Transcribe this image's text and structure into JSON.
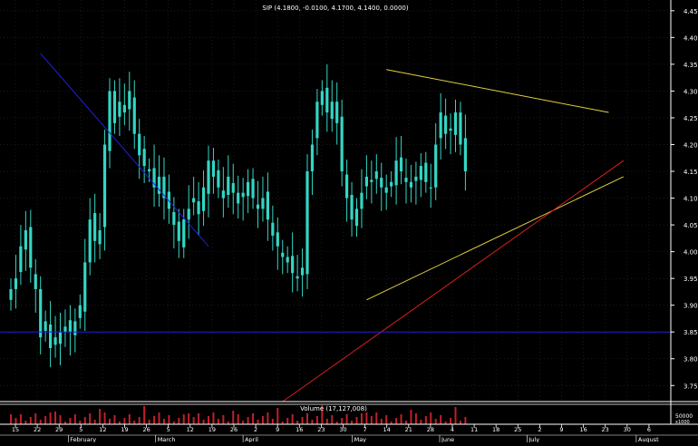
{
  "header": {
    "title": "SIP (4.1800, -0.0100, 4.1700, 4.1400, 0.0000)"
  },
  "volume_label": "Volume (17,127,008)",
  "colors": {
    "background": "#000000",
    "candle": "#33d6c4",
    "downtrend": "#1e22d8",
    "uptrend": "#d81e1e",
    "channel": "#e0d040",
    "support": "#1e22d8",
    "volume": "#c0202a",
    "axis": "#ffffff",
    "grid": "#2a2a2a"
  },
  "chart_data": {
    "type": "candlestick",
    "title": "SIP (4.1800, -0.0100, 4.1700, 4.1400, 0.0000)",
    "ylim": [
      3.72,
      4.47
    ],
    "y_ticks": [
      3.75,
      3.8,
      3.85,
      3.9,
      3.95,
      4.0,
      4.05,
      4.1,
      4.15,
      4.2,
      4.25,
      4.3,
      4.35,
      4.4,
      4.45
    ],
    "x_ticks": [
      "15",
      "22",
      "29",
      "5",
      "12",
      "19",
      "26",
      "5",
      "12",
      "19",
      "26",
      "2",
      "9",
      "16",
      "23",
      "30",
      "7",
      "14",
      "21",
      "28",
      "4",
      "11",
      "18",
      "25",
      "2",
      "9",
      "16",
      "23",
      "30",
      "6"
    ],
    "months": [
      "February",
      "March",
      "April",
      "May",
      "June",
      "July",
      "August"
    ],
    "volume_ticks": [
      "50000",
      "x1000"
    ],
    "closes": [
      3.93,
      3.95,
      4.01,
      4.04,
      3.97,
      3.93,
      3.84,
      3.87,
      3.82,
      3.84,
      3.85,
      3.86,
      3.85,
      3.87,
      3.9,
      3.98,
      4.06,
      4.02,
      4.04,
      4.2,
      4.3,
      4.24,
      4.28,
      4.26,
      4.3,
      4.22,
      4.18,
      4.16,
      4.15,
      4.12,
      4.14,
      4.1,
      4.08,
      4.05,
      4.02,
      4.06,
      4.08,
      4.1,
      4.07,
      4.12,
      4.17,
      4.14,
      4.12,
      4.1,
      4.14,
      4.11,
      4.09,
      4.11,
      4.13,
      4.1,
      4.08,
      4.1,
      4.06,
      4.03,
      4.01,
      3.99,
      3.98,
      3.96,
      3.95,
      3.97,
      4.15,
      4.2,
      4.28,
      4.3,
      4.26,
      4.28,
      4.24,
      4.15,
      4.1,
      4.06,
      4.08,
      4.11,
      4.14,
      4.13,
      4.15,
      4.12,
      4.11,
      4.13,
      4.17,
      4.15,
      4.13,
      4.12,
      4.14,
      4.16,
      4.13,
      4.12,
      4.2,
      4.26,
      4.22,
      4.23,
      4.26,
      4.2,
      4.15
    ],
    "lines": [
      {
        "name": "downtrend",
        "from": [
          6,
          4.37
        ],
        "to": [
          40,
          4.01
        ]
      },
      {
        "name": "channel-top",
        "from": [
          76,
          4.34
        ],
        "to": [
          121,
          4.26
        ]
      },
      {
        "name": "channel-bottom",
        "from": [
          72,
          3.91
        ],
        "to": [
          124,
          4.14
        ]
      },
      {
        "name": "uptrend",
        "from": [
          55,
          3.72
        ],
        "to": [
          124,
          4.17
        ]
      },
      {
        "name": "support",
        "from": [
          0,
          3.85
        ],
        "to": [
          124,
          3.85
        ]
      }
    ],
    "grid": true
  }
}
